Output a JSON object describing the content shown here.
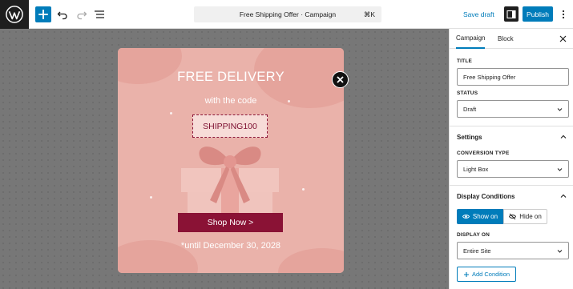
{
  "topbar": {
    "title": "Free Shipping Offer · Campaign",
    "shortcut": "⌘K",
    "save_draft": "Save draft",
    "publish": "Publish"
  },
  "popup": {
    "title": "FREE DELIVERY",
    "subtitle": "with the code",
    "code": "SHIPPING100",
    "cta": "Shop Now >",
    "expiry": "*until December 30, 2028"
  },
  "sidebar": {
    "tabs": [
      "Campaign",
      "Block"
    ],
    "title_label": "TITLE",
    "title_value": "Free Shipping Offer",
    "status_label": "STATUS",
    "status_value": "Draft",
    "settings_title": "Settings",
    "conversion_label": "CONVERSION TYPE",
    "conversion_value": "Light Box",
    "display_title": "Display Conditions",
    "show_on": "Show on",
    "hide_on": "Hide on",
    "display_on_label": "DISPLAY ON",
    "display_on_value": "Entire Site",
    "add_condition": "Add Condition"
  },
  "colors": {
    "accent": "#007cba",
    "popup_bg": "#eab2aa",
    "cta": "#8a1235",
    "canvas": "#777777"
  },
  "icons": [
    "wordpress-icon",
    "plus-icon",
    "undo-icon",
    "redo-icon",
    "list-view-icon",
    "sidebar-toggle-icon",
    "more-icon",
    "close-icon",
    "gift-icon",
    "chevron-down-icon",
    "chevron-up-icon",
    "eye-icon",
    "eye-slash-icon"
  ]
}
